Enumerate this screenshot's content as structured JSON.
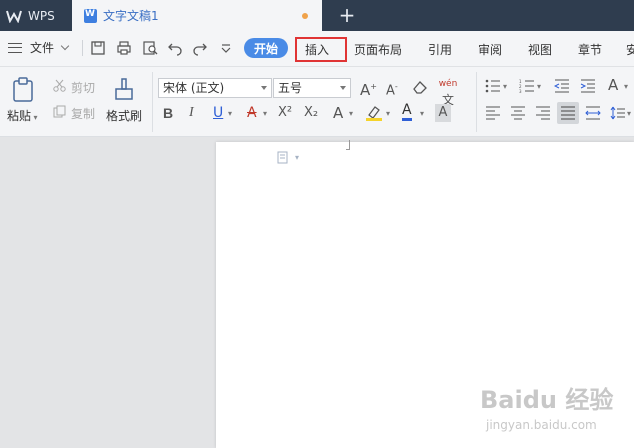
{
  "titlebar": {
    "app_name": "WPS",
    "doc_title": "文字文稿1",
    "new_tab_symbol": "+"
  },
  "menubar": {
    "file_label": "文件",
    "tabs": [
      "开始",
      "插入",
      "页面布局",
      "引用",
      "审阅",
      "视图",
      "章节",
      "安"
    ],
    "active_tab": "开始",
    "highlighted_tab": "插入"
  },
  "ribbon": {
    "paste_label": "粘贴",
    "cut_label": "剪切",
    "copy_label": "复制",
    "format_painter_label": "格式刷",
    "font_name": "宋体 (正文)",
    "font_size": "五号",
    "bold": "B",
    "italic": "I",
    "underline": "U",
    "strikethrough": "A",
    "superscript": "X²",
    "subscript": "X₂",
    "font_effect": "A",
    "highlight_color": "#f5d32a",
    "font_color": "#2f5fd6",
    "char_shading": "A",
    "grow_font": "A",
    "shrink_font": "A",
    "clear_format_icon": "eraser-icon",
    "pinyin_icon": "wén",
    "change_case": "A"
  },
  "watermark": {
    "brand": "Baidu 经验",
    "url": "jingyan.baidu.com"
  },
  "colors": {
    "titlebar_bg": "#2f3d4f",
    "accent_blue": "#4a8be6",
    "highlight_red": "#e03434"
  }
}
